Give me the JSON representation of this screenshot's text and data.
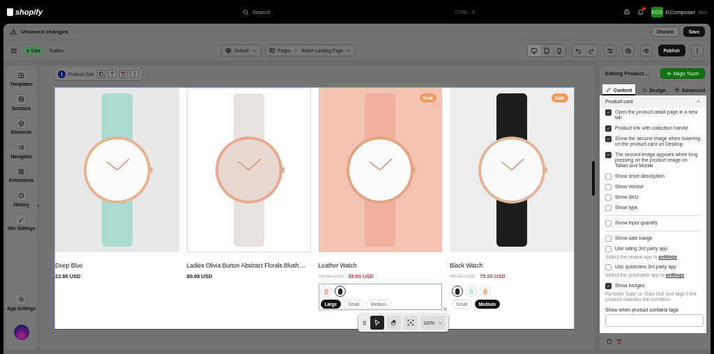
{
  "topbar": {
    "brand": "shopify",
    "search": {
      "placeholder": "Search",
      "shortcut": [
        "CTRL",
        "K"
      ]
    },
    "notifications": {
      "unread": true
    },
    "store": {
      "initials": "ECO",
      "name": "EComposer",
      "suffix": "dev"
    }
  },
  "unsaved_bar": {
    "title": "Unsaved changes",
    "buttons": [
      "Discard",
      "Save"
    ]
  },
  "toolbar": {
    "status": "Live",
    "theme": "Kalles",
    "template": "Default",
    "page_type": "Pages",
    "page": "Watch Landing Page",
    "devices": [
      {
        "selected": true
      },
      {
        "selected": false
      },
      {
        "selected": false
      }
    ],
    "publish": "Publish"
  },
  "sidebar": {
    "items": [
      {
        "label": "Templates"
      },
      {
        "label": "Sections"
      },
      {
        "label": "Elements"
      },
      {
        "label": "Navigator"
      },
      {
        "label": "Extensions"
      },
      {
        "label": "History"
      },
      {
        "label": "Site Settings"
      }
    ],
    "footer": {
      "label": "App Settings"
    }
  },
  "canvas": {
    "block_toolbar": {
      "initial": "t",
      "name": "Product Grid"
    },
    "products": [
      {
        "name": "Deep Blue",
        "price": "22.00 USD"
      },
      {
        "name": "Ladies Olivia Burton Abstract Florals Blush ...",
        "price": "80.00 USD"
      },
      {
        "name": "Leather Watch",
        "badge": "Sale",
        "compare_price": "75.00 USD",
        "price": "35.00 USD",
        "focused": true,
        "swatches": [
          {
            "selected": false
          },
          {
            "selected": true
          }
        ],
        "sizes": [
          {
            "label": "Large",
            "selected": true
          },
          {
            "label": "Small",
            "selected": false
          },
          {
            "label": "Medium",
            "selected": false
          }
        ]
      },
      {
        "name": "Black Watch",
        "badge": "Sale",
        "compare_price": "95.00 USD",
        "price": "75.00 USD",
        "focused": false,
        "swatches": [
          {
            "selected": true
          },
          {
            "selected": false
          },
          {
            "selected": false
          }
        ],
        "sizes": [
          {
            "label": "Small",
            "selected": false
          },
          {
            "label": "Medium",
            "selected": true
          }
        ]
      }
    ],
    "controls": {
      "tools": [
        {
          "selected": true
        },
        {
          "selected": false
        },
        {
          "selected": false
        }
      ],
      "zoom": "100%"
    }
  },
  "panel": {
    "title": "Editing Product ...",
    "magic_button": "Magic Touch",
    "tabs": [
      {
        "label": "Content",
        "selected": true
      },
      {
        "label": "Design",
        "selected": false
      },
      {
        "label": "Advanced",
        "selected": false
      }
    ],
    "section": {
      "title": "Product card",
      "expanded": true
    },
    "options": [
      {
        "kind": "checkbox",
        "label": "Open the product detail page in a new tab",
        "checked": true
      },
      {
        "kind": "checkbox",
        "label": "Product link with collection handle",
        "checked": true
      },
      {
        "kind": "checkbox",
        "label": "Show the second image when hovering on the product card on Desktop",
        "checked": true
      },
      {
        "kind": "checkbox",
        "label": "The second image appears when long pressing on the product image on Tablet and Mobile",
        "checked": true
      },
      {
        "kind": "checkbox",
        "label": "Show short description",
        "checked": false
      },
      {
        "kind": "checkbox",
        "label": "Show vendor",
        "checked": false
      },
      {
        "kind": "checkbox",
        "label": "Show SKU",
        "checked": false
      },
      {
        "kind": "checkbox",
        "label": "Show type",
        "checked": false
      },
      {
        "kind": "divider"
      },
      {
        "kind": "checkbox",
        "label": "Show input quantity",
        "checked": false
      },
      {
        "kind": "divider"
      },
      {
        "kind": "checkbox",
        "label": "Show sale badge",
        "checked": false
      },
      {
        "kind": "checkbox",
        "label": "Use rating 3rd party app",
        "checked": false,
        "hint": "Select the review app in",
        "link": "settings"
      },
      {
        "kind": "checkbox",
        "label": "Use quickview 3rd party app",
        "checked": false,
        "hint": "Select the quickview app in",
        "link": "settings"
      },
      {
        "kind": "checkbox",
        "label": "Show badges",
        "checked": true,
        "hint": "Renders 'Sale' or 'Sold Out' and tags if the product matches the condition"
      },
      {
        "kind": "field",
        "label": "Show when product contains tags"
      }
    ]
  }
}
